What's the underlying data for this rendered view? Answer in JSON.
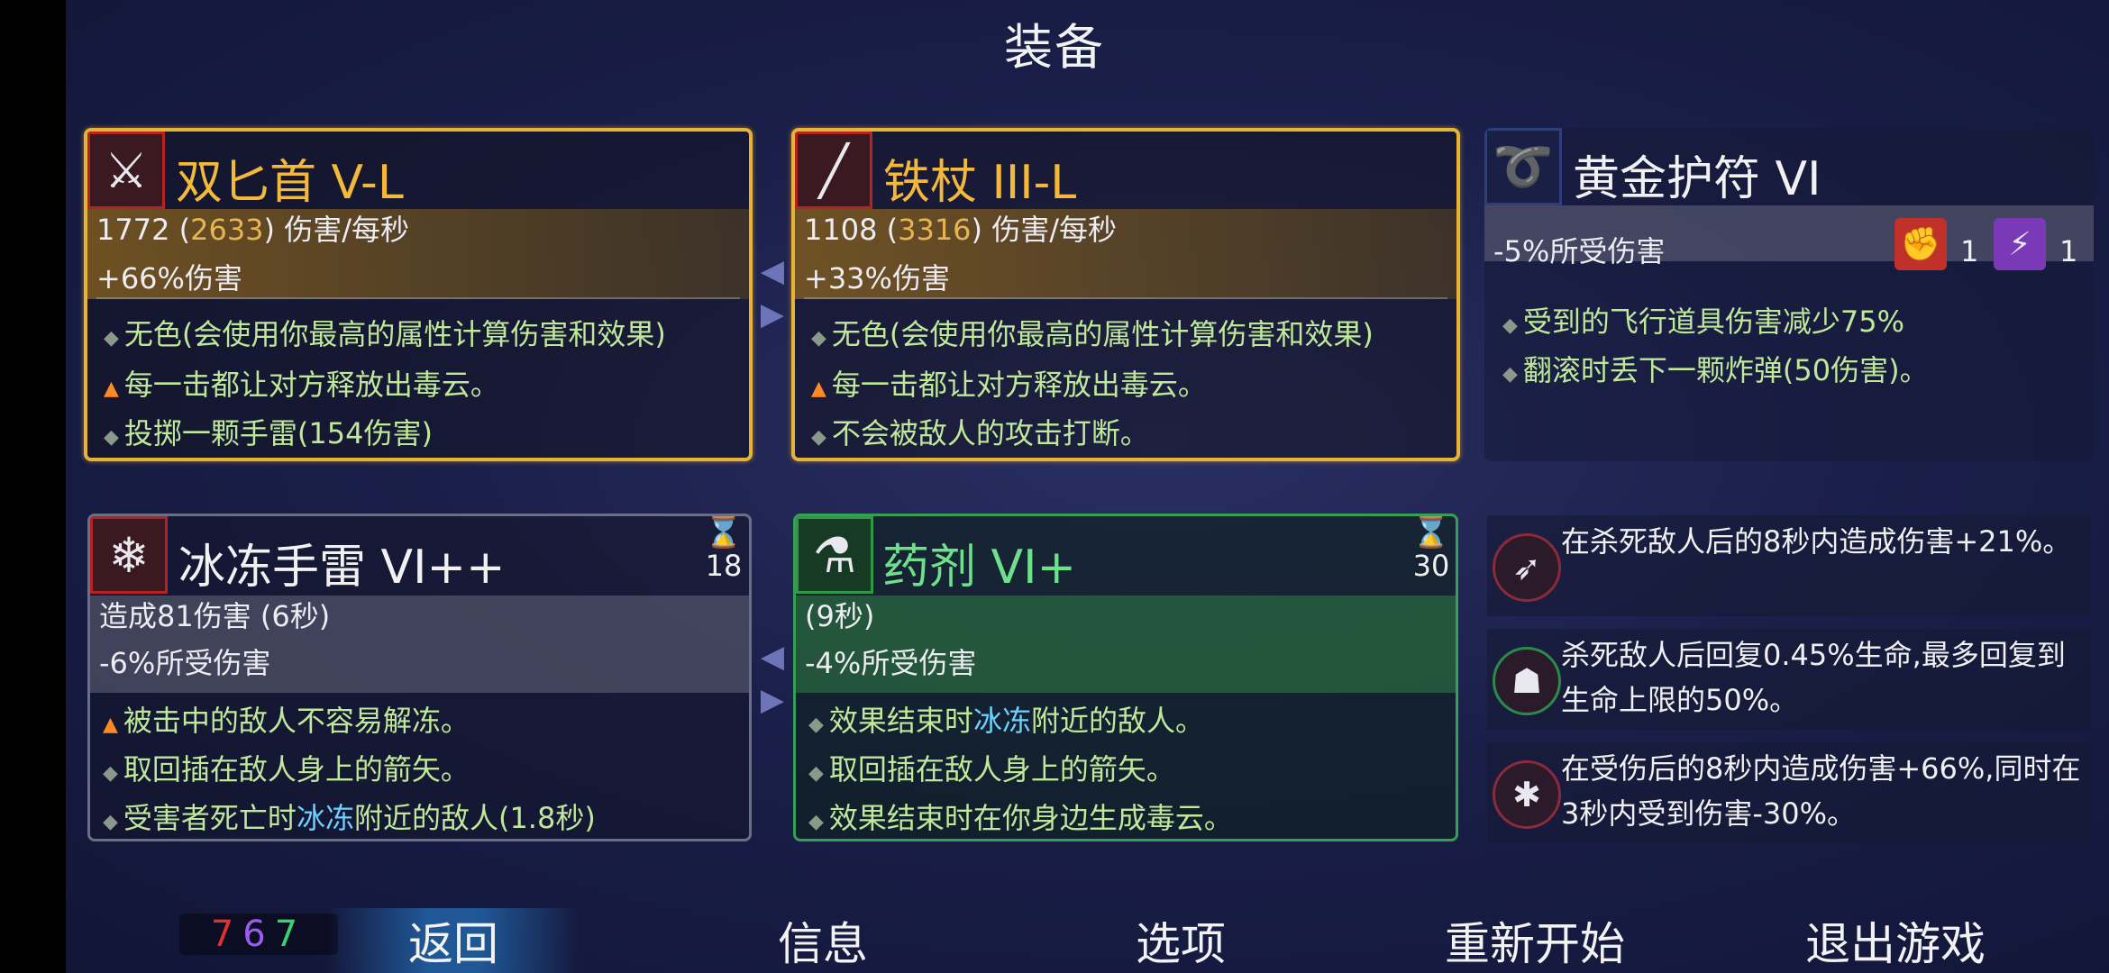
{
  "title": "装备",
  "weapons": [
    {
      "name": "双匕首 V-L",
      "dps_base": "1772",
      "dps_alt": "2633",
      "dps_unit": "伤害/每秒",
      "stat": "+66%伤害",
      "icon": "crossed-daggers-icon",
      "bullets": [
        "无色(会使用你最高的属性计算伤害和效果)",
        "每一击都让对方释放出毒云。",
        "投掷一颗手雷(154伤害)"
      ]
    },
    {
      "name": "铁杖 III-L",
      "dps_base": "1108",
      "dps_alt": "3316",
      "dps_unit": "伤害/每秒",
      "stat": "+33%伤害",
      "icon": "iron-staff-icon",
      "bullets": [
        "无色(会使用你最高的属性计算伤害和效果)",
        "每一击都让对方释放出毒云。",
        "不会被敌人的攻击打断。"
      ]
    }
  ],
  "amulet": {
    "name": "黄金护符 VI",
    "stat": "-5%所受伤害",
    "icon": "amulet-icon",
    "badges": [
      {
        "icon": "fist-scroll-icon",
        "count": "1"
      },
      {
        "icon": "lightning-scroll-icon",
        "count": "1"
      }
    ],
    "bullets": [
      "受到的飞行道具伤害减少75%",
      "翻滚时丢下一颗炸弹(50伤害)。"
    ]
  },
  "skills": [
    {
      "name": "冰冻手雷 VI++",
      "cooldown": "18",
      "line1": "造成81伤害 (6秒)",
      "stat": "-6%所受伤害",
      "icon": "ice-grenade-icon",
      "bullets": [
        {
          "pre": "被击中的敌人不容易解冻。",
          "hl": "",
          "post": ""
        },
        {
          "pre": "取回插在敌人身上的箭矢。",
          "hl": "",
          "post": ""
        },
        {
          "pre": "受害者死亡时",
          "hl": "冰冻",
          "post": "附近的敌人(1.8秒)"
        }
      ]
    },
    {
      "name": "药剂 VI+",
      "cooldown": "30",
      "line1": "(9秒)",
      "stat": "-4%所受伤害",
      "icon": "potion-icon",
      "bullets": [
        {
          "pre": "效果结束时",
          "hl": "冰冻",
          "post": "附近的敌人。"
        },
        {
          "pre": "取回插在敌人身上的箭矢。",
          "hl": "",
          "post": ""
        },
        {
          "pre": "效果结束时在你身边生成毒云。",
          "hl": "",
          "post": ""
        }
      ]
    }
  ],
  "passives": [
    {
      "icon": "crossbow-mutation-icon",
      "text": "在杀死敌人后的8秒内造成伤害+21%。"
    },
    {
      "icon": "fang-mutation-icon",
      "text": "杀死敌人后回复0.45%生命,最多回复到生命上限的50%。"
    },
    {
      "icon": "spider-mutation-icon",
      "text": "在受伤后的8秒内造成伤害+66%,同时在3秒内受到伤害-30%。"
    }
  ],
  "counters": [
    {
      "value": "7",
      "color": "#e03030"
    },
    {
      "value": "6",
      "color": "#9a5cf0"
    },
    {
      "value": "7",
      "color": "#3cd070"
    }
  ],
  "nav": {
    "back": "返回",
    "info": "信息",
    "options": "选项",
    "restart": "重新开始",
    "quit": "退出游戏"
  }
}
